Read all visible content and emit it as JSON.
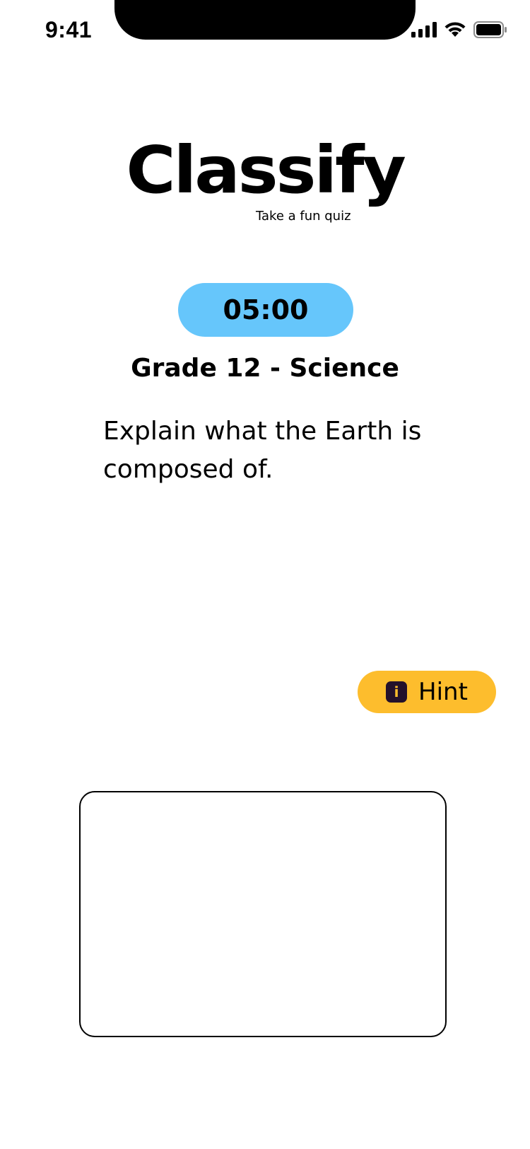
{
  "status_bar": {
    "time": "9:41",
    "icons": [
      "signal-icon",
      "wifi-icon",
      "battery-icon"
    ]
  },
  "logo": {
    "title": "Classify",
    "tagline": "Take a fun quiz"
  },
  "timer": {
    "value": "05:00",
    "color": "#66c6fb"
  },
  "quiz": {
    "subject": "Grade 12 - Science",
    "question": "Explain what the Earth is composed of."
  },
  "hint": {
    "label": "Hint",
    "icon_glyph": "i",
    "color": "#fdbd2d"
  },
  "answer": {
    "value": "",
    "placeholder": ""
  }
}
